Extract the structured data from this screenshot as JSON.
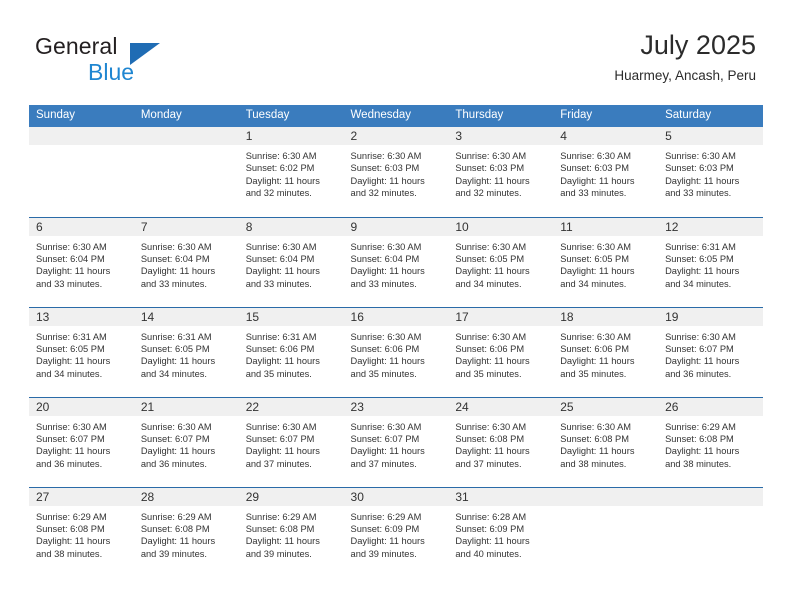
{
  "brand": {
    "name_part1": "General",
    "name_part2": "Blue",
    "logo_icon": "triangle-flag-icon"
  },
  "header": {
    "title": "July 2025",
    "location": "Huarmey, Ancash, Peru"
  },
  "colors": {
    "header_blue": "#3a7cbe",
    "row_divider_blue": "#2a6ba8",
    "daynum_band": "#f0f0f0",
    "brand_blue": "#1f86d1",
    "logo_blue": "#1f6cb4",
    "text": "#333333"
  },
  "weekdays": [
    "Sunday",
    "Monday",
    "Tuesday",
    "Wednesday",
    "Thursday",
    "Friday",
    "Saturday"
  ],
  "labels": {
    "sunrise_prefix": "Sunrise:",
    "sunset_prefix": "Sunset:",
    "daylight_prefix": "Daylight:"
  },
  "weeks": [
    [
      {
        "day": ""
      },
      {
        "day": ""
      },
      {
        "day": "1",
        "sunrise": "Sunrise: 6:30 AM",
        "sunset": "Sunset: 6:02 PM",
        "daylight": "Daylight: 11 hours and 32 minutes."
      },
      {
        "day": "2",
        "sunrise": "Sunrise: 6:30 AM",
        "sunset": "Sunset: 6:03 PM",
        "daylight": "Daylight: 11 hours and 32 minutes."
      },
      {
        "day": "3",
        "sunrise": "Sunrise: 6:30 AM",
        "sunset": "Sunset: 6:03 PM",
        "daylight": "Daylight: 11 hours and 32 minutes."
      },
      {
        "day": "4",
        "sunrise": "Sunrise: 6:30 AM",
        "sunset": "Sunset: 6:03 PM",
        "daylight": "Daylight: 11 hours and 33 minutes."
      },
      {
        "day": "5",
        "sunrise": "Sunrise: 6:30 AM",
        "sunset": "Sunset: 6:03 PM",
        "daylight": "Daylight: 11 hours and 33 minutes."
      }
    ],
    [
      {
        "day": "6",
        "sunrise": "Sunrise: 6:30 AM",
        "sunset": "Sunset: 6:04 PM",
        "daylight": "Daylight: 11 hours and 33 minutes."
      },
      {
        "day": "7",
        "sunrise": "Sunrise: 6:30 AM",
        "sunset": "Sunset: 6:04 PM",
        "daylight": "Daylight: 11 hours and 33 minutes."
      },
      {
        "day": "8",
        "sunrise": "Sunrise: 6:30 AM",
        "sunset": "Sunset: 6:04 PM",
        "daylight": "Daylight: 11 hours and 33 minutes."
      },
      {
        "day": "9",
        "sunrise": "Sunrise: 6:30 AM",
        "sunset": "Sunset: 6:04 PM",
        "daylight": "Daylight: 11 hours and 33 minutes."
      },
      {
        "day": "10",
        "sunrise": "Sunrise: 6:30 AM",
        "sunset": "Sunset: 6:05 PM",
        "daylight": "Daylight: 11 hours and 34 minutes."
      },
      {
        "day": "11",
        "sunrise": "Sunrise: 6:30 AM",
        "sunset": "Sunset: 6:05 PM",
        "daylight": "Daylight: 11 hours and 34 minutes."
      },
      {
        "day": "12",
        "sunrise": "Sunrise: 6:31 AM",
        "sunset": "Sunset: 6:05 PM",
        "daylight": "Daylight: 11 hours and 34 minutes."
      }
    ],
    [
      {
        "day": "13",
        "sunrise": "Sunrise: 6:31 AM",
        "sunset": "Sunset: 6:05 PM",
        "daylight": "Daylight: 11 hours and 34 minutes."
      },
      {
        "day": "14",
        "sunrise": "Sunrise: 6:31 AM",
        "sunset": "Sunset: 6:05 PM",
        "daylight": "Daylight: 11 hours and 34 minutes."
      },
      {
        "day": "15",
        "sunrise": "Sunrise: 6:31 AM",
        "sunset": "Sunset: 6:06 PM",
        "daylight": "Daylight: 11 hours and 35 minutes."
      },
      {
        "day": "16",
        "sunrise": "Sunrise: 6:30 AM",
        "sunset": "Sunset: 6:06 PM",
        "daylight": "Daylight: 11 hours and 35 minutes."
      },
      {
        "day": "17",
        "sunrise": "Sunrise: 6:30 AM",
        "sunset": "Sunset: 6:06 PM",
        "daylight": "Daylight: 11 hours and 35 minutes."
      },
      {
        "day": "18",
        "sunrise": "Sunrise: 6:30 AM",
        "sunset": "Sunset: 6:06 PM",
        "daylight": "Daylight: 11 hours and 35 minutes."
      },
      {
        "day": "19",
        "sunrise": "Sunrise: 6:30 AM",
        "sunset": "Sunset: 6:07 PM",
        "daylight": "Daylight: 11 hours and 36 minutes."
      }
    ],
    [
      {
        "day": "20",
        "sunrise": "Sunrise: 6:30 AM",
        "sunset": "Sunset: 6:07 PM",
        "daylight": "Daylight: 11 hours and 36 minutes."
      },
      {
        "day": "21",
        "sunrise": "Sunrise: 6:30 AM",
        "sunset": "Sunset: 6:07 PM",
        "daylight": "Daylight: 11 hours and 36 minutes."
      },
      {
        "day": "22",
        "sunrise": "Sunrise: 6:30 AM",
        "sunset": "Sunset: 6:07 PM",
        "daylight": "Daylight: 11 hours and 37 minutes."
      },
      {
        "day": "23",
        "sunrise": "Sunrise: 6:30 AM",
        "sunset": "Sunset: 6:07 PM",
        "daylight": "Daylight: 11 hours and 37 minutes."
      },
      {
        "day": "24",
        "sunrise": "Sunrise: 6:30 AM",
        "sunset": "Sunset: 6:08 PM",
        "daylight": "Daylight: 11 hours and 37 minutes."
      },
      {
        "day": "25",
        "sunrise": "Sunrise: 6:30 AM",
        "sunset": "Sunset: 6:08 PM",
        "daylight": "Daylight: 11 hours and 38 minutes."
      },
      {
        "day": "26",
        "sunrise": "Sunrise: 6:29 AM",
        "sunset": "Sunset: 6:08 PM",
        "daylight": "Daylight: 11 hours and 38 minutes."
      }
    ],
    [
      {
        "day": "27",
        "sunrise": "Sunrise: 6:29 AM",
        "sunset": "Sunset: 6:08 PM",
        "daylight": "Daylight: 11 hours and 38 minutes."
      },
      {
        "day": "28",
        "sunrise": "Sunrise: 6:29 AM",
        "sunset": "Sunset: 6:08 PM",
        "daylight": "Daylight: 11 hours and 39 minutes."
      },
      {
        "day": "29",
        "sunrise": "Sunrise: 6:29 AM",
        "sunset": "Sunset: 6:08 PM",
        "daylight": "Daylight: 11 hours and 39 minutes."
      },
      {
        "day": "30",
        "sunrise": "Sunrise: 6:29 AM",
        "sunset": "Sunset: 6:09 PM",
        "daylight": "Daylight: 11 hours and 39 minutes."
      },
      {
        "day": "31",
        "sunrise": "Sunrise: 6:28 AM",
        "sunset": "Sunset: 6:09 PM",
        "daylight": "Daylight: 11 hours and 40 minutes."
      },
      {
        "day": ""
      },
      {
        "day": ""
      }
    ]
  ]
}
